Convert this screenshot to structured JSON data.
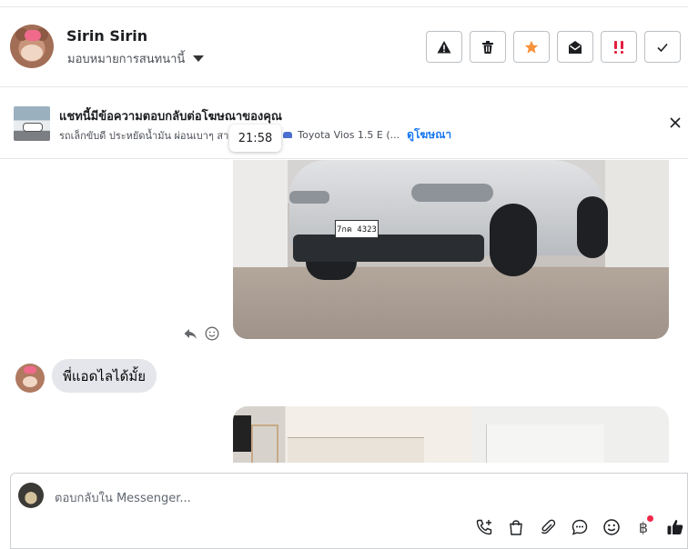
{
  "header": {
    "name": "Sirin Sirin",
    "assign_label": "มอบหมายการสนทนานี้",
    "actions": [
      "report-spam",
      "delete",
      "star",
      "mark-unread",
      "priority",
      "done"
    ]
  },
  "ad_banner": {
    "title": "แชทนี้มีข้อความตอบกลับต่อโฆษณาของคุณ",
    "description": "รถเล็กขับดี ประหยัดน้ำมัน ผ่อนเบาๆ สา",
    "product": "Toyota Vios 1.5 E (...",
    "link": "ดูโฆษณา"
  },
  "tooltip": {
    "time": "21:58"
  },
  "messages": [
    {
      "type": "image",
      "side": "right",
      "plate": "7กค 4323"
    },
    {
      "type": "text",
      "side": "left",
      "text": "พี่แอดไลได้มั้ย"
    },
    {
      "type": "image",
      "side": "right"
    }
  ],
  "composer": {
    "placeholder": "ตอบกลับใน Messenger...",
    "baht_symbol": "฿"
  },
  "colors": {
    "accent": "#1877f2",
    "star": "#f7923b",
    "priority": "#e41e3f",
    "bubble": "#e4e6eb",
    "notification_dot": "#f02849"
  }
}
